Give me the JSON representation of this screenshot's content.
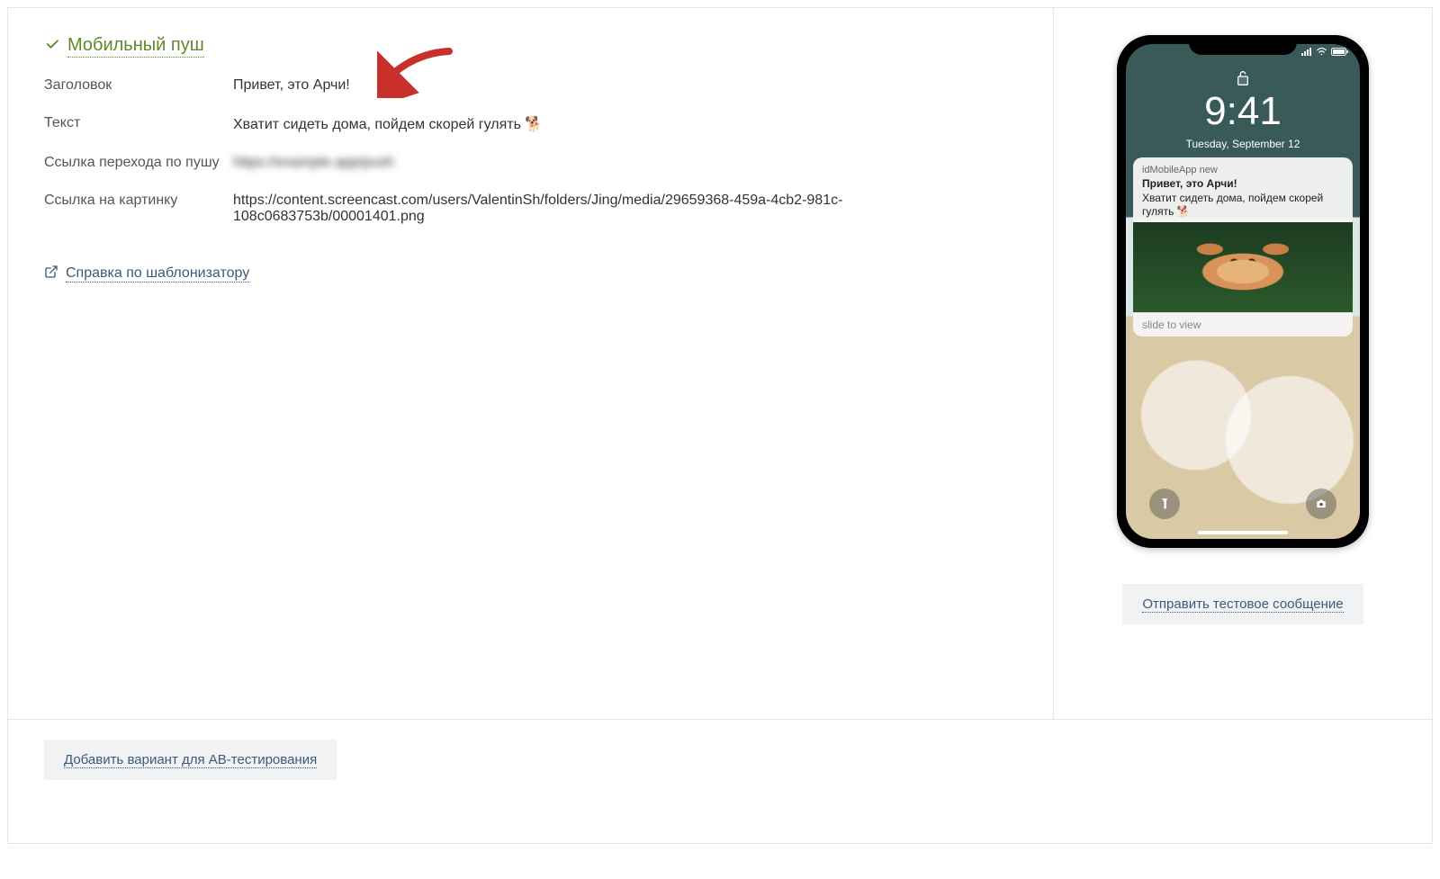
{
  "section": {
    "title": "Мобильный пуш"
  },
  "fields": {
    "title_label": "Заголовок",
    "title_value": "Привет, это Арчи!",
    "text_label": "Текст",
    "text_value": "Хватит сидеть дома, пойдем скорей гулять 🐕",
    "link_label": "Ссылка перехода по пушу",
    "link_value": "https://example.app/push",
    "image_label": "Ссылка на картинку",
    "image_value": "https://content.screencast.com/users/ValentinSh/folders/Jing/media/29659368-459a-4cb2-981c-108c0683753b/00001401.png"
  },
  "help_link": "Справка по шаблонизатору",
  "preview": {
    "time": "9:41",
    "date": "Tuesday, September 12",
    "app": "idMobileApp new",
    "title": "Привет, это Арчи!",
    "text": "Хватит сидеть дома, пойдем скорей гулять 🐕",
    "slide": "slide to view"
  },
  "buttons": {
    "send_test": "Отправить тестовое сообщение",
    "add_ab": "Добавить вариант для AB-тестирования"
  }
}
